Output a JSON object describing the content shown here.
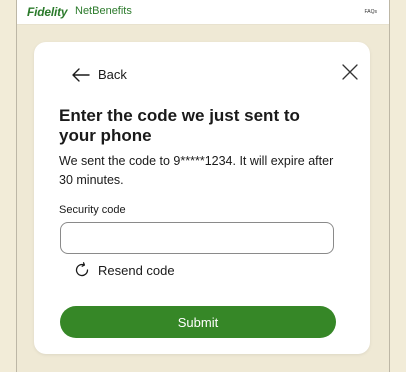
{
  "header": {
    "brand": "Fidelity",
    "product": "NetBenefits",
    "faqs_label": "FAQs"
  },
  "dialog": {
    "back_label": "Back",
    "title": "Enter the code we just sent to your phone",
    "description": "We sent the code to 9*****1234. It will expire after 30 minutes.",
    "field_label": "Security code",
    "field_value": "",
    "field_placeholder": "",
    "resend_label": "Resend code",
    "submit_label": "Submit"
  },
  "colors": {
    "brand_green": "#2b7a2b",
    "button_green": "#368727",
    "page_background": "#f2ecd8"
  },
  "icons": {
    "back": "arrow-left-icon",
    "close": "close-icon",
    "resend": "refresh-icon"
  }
}
